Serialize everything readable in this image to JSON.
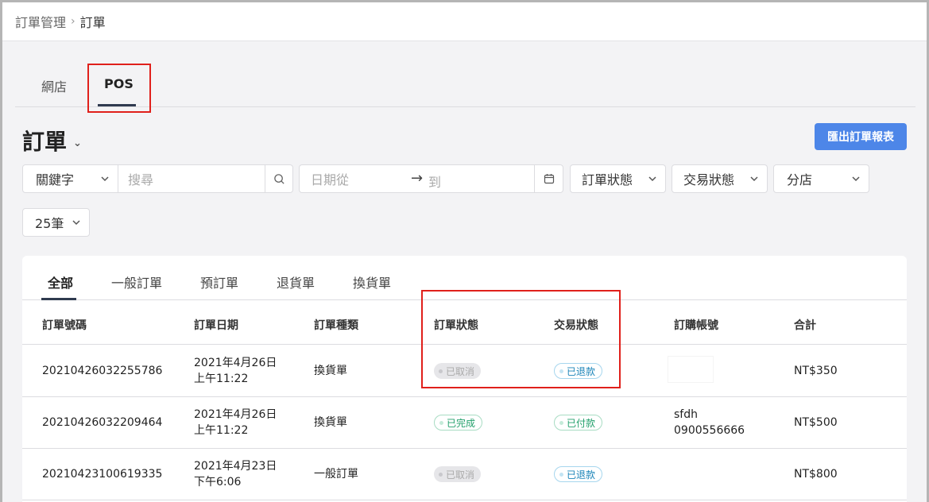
{
  "breadcrumb": {
    "parent": "訂單管理",
    "separator": "›",
    "current": "訂單"
  },
  "channel_tabs": [
    {
      "label": "網店"
    },
    {
      "label": "POS"
    }
  ],
  "page": {
    "title": "訂單",
    "title_chevron": "⌄",
    "export_label": "匯出訂單報表"
  },
  "filters": {
    "keyword_select": "關鍵字",
    "search_placeholder": "搜尋",
    "date_from_placeholder": "日期從",
    "date_arrow": "→",
    "date_to_placeholder": "到",
    "order_status": "訂單狀態",
    "payment_status": "交易狀態",
    "branch": "分店",
    "page_size": "25筆"
  },
  "type_tabs": [
    {
      "label": "全部"
    },
    {
      "label": "一般訂單"
    },
    {
      "label": "預訂單"
    },
    {
      "label": "退貨單"
    },
    {
      "label": "換貨單"
    }
  ],
  "table": {
    "columns": [
      "訂單號碼",
      "訂單日期",
      "訂單種類",
      "訂單狀態",
      "交易狀態",
      "訂購帳號",
      "合計"
    ],
    "rows": [
      {
        "order_no": "20210426032255786",
        "date": "2021年4月26日",
        "time": "上午11:22",
        "type": "換貨單",
        "order_status": "已取消",
        "payment_status": "已退款",
        "account_line1": "",
        "account_line2": "",
        "total": "NT$350"
      },
      {
        "order_no": "20210426032209464",
        "date": "2021年4月26日",
        "time": "上午11:22",
        "type": "換貨單",
        "order_status": "已完成",
        "payment_status": "已付款",
        "account_line1": "sfdh",
        "account_line2": "0900556666",
        "total": "NT$500"
      },
      {
        "order_no": "20210423100619335",
        "date": "2021年4月23日",
        "time": "下午6:06",
        "type": "一般訂單",
        "order_status": "已取消",
        "payment_status": "已退款",
        "account_line1": "",
        "account_line2": "",
        "total": "NT$800"
      }
    ]
  },
  "colors": {
    "accent": "#4d86e8",
    "highlight": "#e0201b",
    "tab_underline": "#2f3a4f"
  }
}
